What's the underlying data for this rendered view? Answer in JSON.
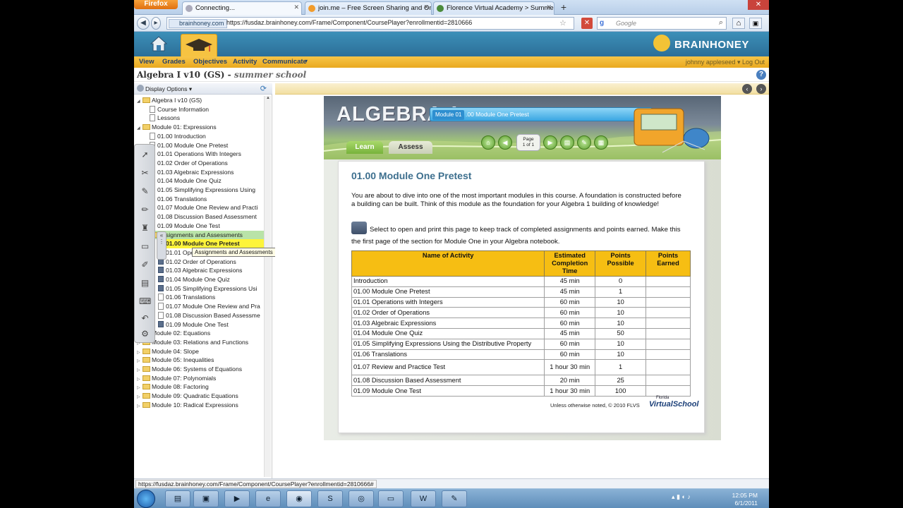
{
  "browser": {
    "firefox_label": "Firefox",
    "tabs": [
      {
        "label": "Connecting...",
        "active": true
      },
      {
        "label": "join.me – Free Screen Sharing and On...",
        "active": false
      },
      {
        "label": "Florence Virtual Academy > Summer ...",
        "active": false
      }
    ],
    "newtab": "+",
    "site_identity": "brainhoney.com",
    "url": "https://fusdaz.brainhoney.com/Frame/Component/CoursePlayer?enrollmentid=2810666",
    "search_placeholder": "Google",
    "status_url": "https://fusdaz.brainhoney.com/Frame/Component/CoursePlayer?enrollmentid=2810666#"
  },
  "header": {
    "logo": "BRAINHONEY",
    "menu": [
      "View",
      "Grades",
      "Objectives",
      "Activity",
      "Communicate"
    ],
    "user": "johnny appleseed",
    "logout": "Log Out",
    "course_title": "Algebra I v10 (GS)",
    "course_subtitle": "summer school"
  },
  "sidebar": {
    "display_options": "Display Options",
    "tooltip": "Assignments and Assessments",
    "tree": [
      {
        "label": "Algebra I v10 (GS)",
        "type": "folder",
        "level": 0,
        "tw": "◢"
      },
      {
        "label": "Course Information",
        "type": "doc",
        "level": 1
      },
      {
        "label": "Lessons",
        "type": "doc",
        "level": 1
      },
      {
        "label": "Module 01: Expressions",
        "type": "folder",
        "level": 0,
        "tw": "◢"
      },
      {
        "label": "01.00 Introduction",
        "type": "doc",
        "level": 1
      },
      {
        "label": "01.00 Module One Pretest",
        "type": "doc",
        "level": 1
      },
      {
        "label": "01.01 Operations With Integers",
        "type": "doc",
        "level": 1
      },
      {
        "label": "01.02 Order of Operations",
        "type": "doc",
        "level": 1
      },
      {
        "label": "01.03 Algebraic Expressions",
        "type": "doc",
        "level": 1
      },
      {
        "label": "01.04 Module One Quiz",
        "type": "doc",
        "level": 1
      },
      {
        "label": "01.05 Simplifying Expressions Using",
        "type": "doc",
        "level": 1
      },
      {
        "label": "01.06 Translations",
        "type": "doc",
        "level": 1
      },
      {
        "label": "01.07 Module One Review and Practi",
        "type": "doc",
        "level": 1
      },
      {
        "label": "01.08 Discussion Based Assessment",
        "type": "doc",
        "level": 1
      },
      {
        "label": "01.09 Module One Test",
        "type": "doc",
        "level": 1
      },
      {
        "label": "Assignments and Assessments",
        "type": "folder",
        "level": 1,
        "hl": "green"
      },
      {
        "label": "01.00 Module One Pretest",
        "type": "q",
        "level": 2,
        "hl": "yellow"
      },
      {
        "label": "01.01 Operations With Integers",
        "type": "q",
        "level": 2
      },
      {
        "label": "01.02 Order of Operations",
        "type": "q",
        "level": 2
      },
      {
        "label": "01.03 Algebraic Expressions",
        "type": "q",
        "level": 2
      },
      {
        "label": "01.04 Module One Quiz",
        "type": "q",
        "level": 2
      },
      {
        "label": "01.05 Simplifying Expressions Usi",
        "type": "q",
        "level": 2
      },
      {
        "label": "01.06 Translations",
        "type": "doc",
        "level": 2
      },
      {
        "label": "01.07 Module One Review and Pra",
        "type": "doc",
        "level": 2
      },
      {
        "label": "01.08 Discussion Based Assessme",
        "type": "doc",
        "level": 2
      },
      {
        "label": "01.09 Module One Test",
        "type": "q",
        "level": 2
      },
      {
        "label": "Module 02: Equations",
        "type": "folder",
        "level": 0,
        "tw": "▷"
      },
      {
        "label": "Module 03: Relations and Functions",
        "type": "folder",
        "level": 0,
        "tw": "▷"
      },
      {
        "label": "Module 04: Slope",
        "type": "folder",
        "level": 0,
        "tw": "▷"
      },
      {
        "label": "Module 05: Inequalities",
        "type": "folder",
        "level": 0,
        "tw": "▷"
      },
      {
        "label": "Module 06: Systems of Equations",
        "type": "folder",
        "level": 0,
        "tw": "▷"
      },
      {
        "label": "Module 07: Polynomials",
        "type": "folder",
        "level": 0,
        "tw": "▷"
      },
      {
        "label": "Module 08: Factoring",
        "type": "folder",
        "level": 0,
        "tw": "▷"
      },
      {
        "label": "Module 09: Quadratic Equations",
        "type": "folder",
        "level": 0,
        "tw": "▷"
      },
      {
        "label": "Module 10: Radical Expressions",
        "type": "folder",
        "level": 0,
        "tw": "▷"
      }
    ]
  },
  "lesson": {
    "banner_title": "ALGEBRA 1",
    "module_chip": "Module 01",
    "module_name": ".00 Module One Pretest",
    "tab_learn": "Learn",
    "tab_assess": "Assess",
    "page_label": "Page",
    "page_count": "1 of 1",
    "title": "01.00 Module One Pretest",
    "intro": "You are about to dive into one of the most important modules in this course. A foundation is constructed before a building can be built. Think of this module as the foundation for your Algebra 1 building of knowledge!",
    "print_note": "Select to open and print this page to keep track of completed assignments and points earned. Make this the first page of the section for Module One in your Algebra notebook.",
    "table_headers": [
      "Name of Activity",
      "Estimated Completion Time",
      "Points Possible",
      "Points Earned"
    ],
    "table_rows": [
      [
        "Introduction",
        "45 min",
        "0",
        ""
      ],
      [
        "01.00 Module One Pretest",
        "45 min",
        "1",
        ""
      ],
      [
        "01.01 Operations with Integers",
        "60 min",
        "10",
        ""
      ],
      [
        "01.02 Order of Operations",
        "60 min",
        "10",
        ""
      ],
      [
        "01.03 Algebraic Expressions",
        "60 min",
        "10",
        ""
      ],
      [
        "01.04 Module One Quiz",
        "45 min",
        "50",
        ""
      ],
      [
        "01.05 Simplifying Expressions Using the Distributive Property",
        "60 min",
        "10",
        ""
      ],
      [
        "01.06 Translations",
        "60 min",
        "10",
        ""
      ],
      [
        "01.07 Review and Practice Test",
        "1 hour 30 min",
        "1",
        ""
      ],
      [
        "01.08 Discussion Based Assessment",
        "20 min",
        "25",
        ""
      ],
      [
        "01.09 Module One Test",
        "1 hour 30 min",
        "100",
        ""
      ]
    ],
    "footer_note": "Unless otherwise noted, © 2010 FLVS",
    "fvs_small": "Florida",
    "fvs_main": "VirtualSchool"
  },
  "taskbar": {
    "time": "12:05 PM",
    "date": "6/1/2011"
  }
}
